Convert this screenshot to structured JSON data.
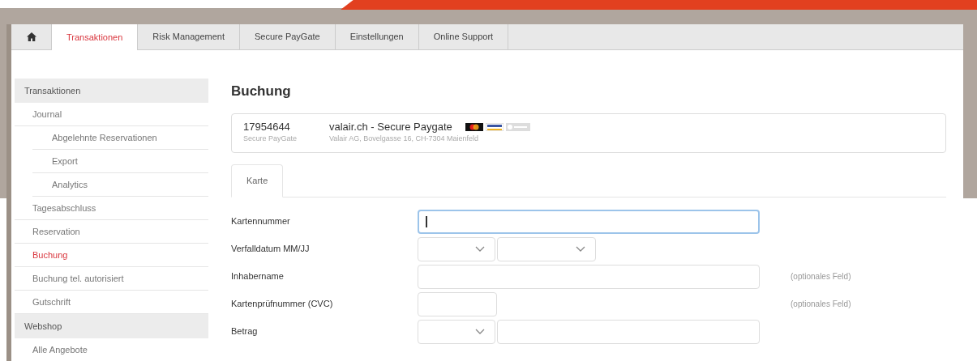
{
  "nav_tabs": [
    {
      "label": "Transaktionen",
      "selected": true
    },
    {
      "label": "Risk Management",
      "selected": false
    },
    {
      "label": "Secure PayGate",
      "selected": false
    },
    {
      "label": "Einstellungen",
      "selected": false
    },
    {
      "label": "Online Support",
      "selected": false
    }
  ],
  "sidebar": {
    "sections": [
      {
        "title": "Transaktionen",
        "items": [
          {
            "label": "Journal",
            "selected": false,
            "children": [
              {
                "label": "Abgelehnte Reservationen",
                "selected": false
              },
              {
                "label": "Export",
                "selected": false
              },
              {
                "label": "Analytics",
                "selected": false
              }
            ]
          },
          {
            "label": "Tagesabschluss",
            "selected": false
          },
          {
            "label": "Reservation",
            "selected": false
          },
          {
            "label": "Buchung",
            "selected": true
          },
          {
            "label": "Buchung tel. autorisiert",
            "selected": false
          },
          {
            "label": "Gutschrift",
            "selected": false
          }
        ]
      },
      {
        "title": "Webshop",
        "items": [
          {
            "label": "Alle Angebote",
            "selected": false
          }
        ]
      }
    ]
  },
  "page_title": "Buchung",
  "merchant": {
    "id": "17954644",
    "id_caption": "Secure PayGate",
    "name": "valair.ch - Secure Paygate",
    "address": "Valair AG, Bovelgasse 16, CH-7304 Maienfeld"
  },
  "form_tabs": [
    {
      "label": "Karte",
      "selected": true
    }
  ],
  "fields": [
    {
      "label": "Kartennummer",
      "kind": "text",
      "focused": true
    },
    {
      "label": "Verfalldatum MM/JJ",
      "kind": "select-pair",
      "focused": false
    },
    {
      "label": "Inhabername",
      "kind": "text",
      "focused": false,
      "note": "(optionales Feld)"
    },
    {
      "label": "Kartenprüfnummer (CVC)",
      "kind": "short-text",
      "focused": false,
      "note": "(optionales Feld)"
    },
    {
      "label": "Betrag",
      "kind": "select-text",
      "focused": false
    }
  ]
}
